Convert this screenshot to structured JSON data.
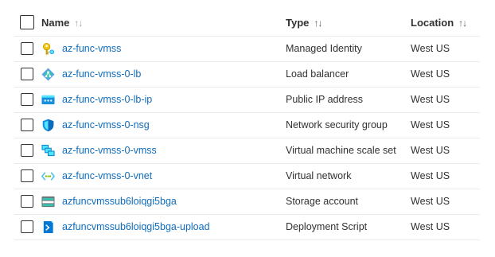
{
  "header": {
    "name_label": "Name",
    "type_label": "Type",
    "location_label": "Location",
    "sort_glyph": "↑↓"
  },
  "rows": [
    {
      "name": "az-func-vmss",
      "type": "Managed Identity",
      "location": "West US",
      "icon": "managed-identity-icon"
    },
    {
      "name": "az-func-vmss-0-lb",
      "type": "Load balancer",
      "location": "West US",
      "icon": "load-balancer-icon"
    },
    {
      "name": "az-func-vmss-0-lb-ip",
      "type": "Public IP address",
      "location": "West US",
      "icon": "public-ip-icon"
    },
    {
      "name": "az-func-vmss-0-nsg",
      "type": "Network security group",
      "location": "West US",
      "icon": "network-security-group-icon"
    },
    {
      "name": "az-func-vmss-0-vmss",
      "type": "Virtual machine scale set",
      "location": "West US",
      "icon": "vmss-icon"
    },
    {
      "name": "az-func-vmss-0-vnet",
      "type": "Virtual network",
      "location": "West US",
      "icon": "virtual-network-icon"
    },
    {
      "name": "azfuncvmssub6loiqgi5bga",
      "type": "Storage account",
      "location": "West US",
      "icon": "storage-account-icon"
    },
    {
      "name": "azfuncvmssub6loiqgi5bga-upload",
      "type": "Deployment Script",
      "location": "West US",
      "icon": "deployment-script-icon"
    }
  ]
}
